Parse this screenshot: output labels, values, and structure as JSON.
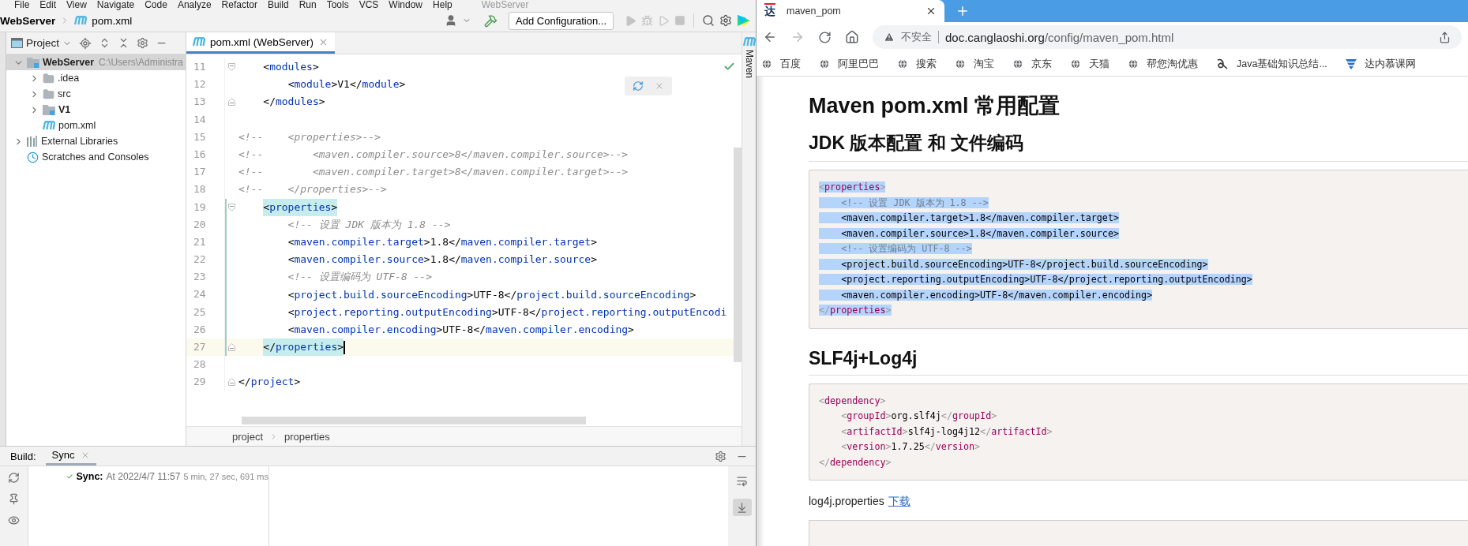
{
  "ide": {
    "menu": [
      "File",
      "Edit",
      "View",
      "Navigate",
      "Code",
      "Analyze",
      "Refactor",
      "Build",
      "Run",
      "Tools",
      "VCS",
      "Window",
      "Help"
    ],
    "title": "WebServer",
    "breadcrumb": [
      "WebServer",
      "pom.xml"
    ],
    "run_config": "Add Configuration...",
    "project": {
      "title": "Project",
      "tree": [
        {
          "label": "WebServer",
          "detail": "C:\\Users\\Administra",
          "kind": "module",
          "expanded": true,
          "selected": true,
          "children": [
            {
              "label": ".idea",
              "kind": "folder",
              "expanded": false,
              "selected": false
            },
            {
              "label": "src",
              "kind": "folder",
              "expanded": false,
              "selected": false
            },
            {
              "label": "V1",
              "kind": "module",
              "expanded": false,
              "selected": false
            },
            {
              "label": "pom.xml",
              "kind": "maven",
              "selected": false
            }
          ]
        },
        {
          "label": "External Libraries",
          "kind": "libraries",
          "expanded": false,
          "selected": false
        },
        {
          "label": "Scratches and Consoles",
          "kind": "scratches",
          "selected": false
        }
      ]
    },
    "editor": {
      "tab": {
        "label": "pom.xml (WebServer)",
        "selected": true
      },
      "lines": [
        {
          "n": "11",
          "kind": "code",
          "text": "    <modules>",
          "matched": false,
          "changed": false,
          "current": false,
          "fold_start": true,
          "fold_end": false
        },
        {
          "n": "12",
          "kind": "code",
          "text": "        <module>V1</module>",
          "matched": false,
          "changed": false,
          "current": false,
          "fold_start": false,
          "fold_end": false
        },
        {
          "n": "13",
          "kind": "code",
          "text": "    </modules>",
          "matched": false,
          "changed": false,
          "current": false,
          "fold_start": false,
          "fold_end": true
        },
        {
          "n": "14",
          "changed": false,
          "current": false,
          "fold_start": false,
          "fold_end": false
        },
        {
          "n": "15",
          "kind": "comment",
          "text": "<!--    <properties>-->",
          "changed": false,
          "current": false,
          "fold_start": false,
          "fold_end": false
        },
        {
          "n": "16",
          "kind": "comment",
          "text": "<!--        <maven.compiler.source>8</maven.compiler.source>-->",
          "changed": false,
          "current": false,
          "fold_start": false,
          "fold_end": false
        },
        {
          "n": "17",
          "kind": "comment",
          "text": "<!--        <maven.compiler.target>8</maven.compiler.target>-->",
          "changed": false,
          "current": false,
          "fold_start": false,
          "fold_end": false
        },
        {
          "n": "18",
          "kind": "comment",
          "text": "<!--    </properties>-->",
          "changed": false,
          "current": false,
          "fold_start": false,
          "fold_end": false
        },
        {
          "n": "19",
          "kind": "code",
          "text": "    <properties>",
          "matched": true,
          "changed": true,
          "current": false,
          "fold_start": true,
          "fold_end": false
        },
        {
          "n": "20",
          "kind": "comment",
          "text": "        <!-- 设置 JDK 版本为 1.8 -->",
          "changed": true,
          "current": false,
          "fold_start": false,
          "fold_end": false
        },
        {
          "n": "21",
          "kind": "code",
          "text": "        <maven.compiler.target>1.8</maven.compiler.target>",
          "matched": false,
          "changed": true,
          "current": false,
          "fold_start": false,
          "fold_end": false
        },
        {
          "n": "22",
          "kind": "code",
          "text": "        <maven.compiler.source>1.8</maven.compiler.source>",
          "matched": false,
          "changed": true,
          "current": false,
          "fold_start": false,
          "fold_end": false
        },
        {
          "n": "23",
          "kind": "comment",
          "text": "        <!-- 设置编码为 UTF-8 -->",
          "changed": true,
          "current": false,
          "fold_start": false,
          "fold_end": false
        },
        {
          "n": "24",
          "kind": "code",
          "text": "        <project.build.sourceEncoding>UTF-8</project.build.sourceEncoding>",
          "matched": false,
          "changed": true,
          "current": false,
          "fold_start": false,
          "fold_end": false
        },
        {
          "n": "25",
          "kind": "code",
          "text": "        <project.reporting.outputEncoding>UTF-8</project.reporting.outputEncodi",
          "matched": false,
          "changed": true,
          "current": false,
          "fold_start": false,
          "fold_end": false
        },
        {
          "n": "26",
          "kind": "code",
          "text": "        <maven.compiler.encoding>UTF-8</maven.compiler.encoding>",
          "matched": false,
          "changed": true,
          "current": false,
          "fold_start": false,
          "fold_end": false
        },
        {
          "n": "27",
          "kind": "code",
          "text": "    </properties>",
          "matched": true,
          "changed": true,
          "current": true,
          "fold_start": false,
          "fold_end": true
        },
        {
          "n": "28",
          "changed": false,
          "current": false,
          "fold_start": false,
          "fold_end": false
        },
        {
          "n": "29",
          "kind": "code",
          "text": "</project>",
          "matched": false,
          "changed": false,
          "current": false,
          "fold_start": false,
          "fold_end": true
        }
      ],
      "breadcrumb": [
        "project",
        "properties"
      ]
    },
    "side_tool": "Maven",
    "build": {
      "label": "Build:",
      "tabs": [
        {
          "label": "Sync",
          "selected": true
        }
      ],
      "rows": [
        {
          "title": "Sync:",
          "time": "At 2022/4/7 11:57",
          "duration": "5 min, 27 sec, 691 ms",
          "kind": "success"
        }
      ],
      "toggles": [
        {
          "kind": "wrap",
          "on": false
        },
        {
          "kind": "scroll",
          "on": true
        }
      ]
    }
  },
  "browser": {
    "tab": {
      "favicon": "达",
      "title": "maven_pom"
    },
    "address": {
      "warning": "不安全",
      "url": "doc.canglaoshi.org/config/maven_pom.html"
    },
    "bookmarks": [
      {
        "label": "百度",
        "kind": "globe"
      },
      {
        "label": "阿里巴巴",
        "kind": "globe"
      },
      {
        "label": "搜索",
        "kind": "globe"
      },
      {
        "label": "淘宝",
        "kind": "globe"
      },
      {
        "label": "京东",
        "kind": "globe"
      },
      {
        "label": "天猫",
        "kind": "globe"
      },
      {
        "label": "帮您淘优惠",
        "kind": "globe"
      },
      {
        "label": "Java基础知识总结...",
        "kind": "swirl"
      },
      {
        "label": "达内慕课网",
        "kind": "funnel"
      }
    ],
    "page": {
      "title": "Maven pom.xml 常用配置",
      "sections": [
        {
          "heading": "JDK 版本配置 和 文件编码",
          "code": {
            "selected": true,
            "lines": [
              {
                "kind": "markup",
                "text": "<properties>"
              },
              {
                "kind": "comment",
                "text": "    <!-- 设置 JDK 版本为 1.8 -->"
              },
              {
                "kind": "plain",
                "text": "    <maven.compiler.target>1.8</maven.compiler.target>"
              },
              {
                "kind": "plain",
                "text": "    <maven.compiler.source>1.8</maven.compiler.source>"
              },
              {
                "kind": "comment",
                "text": "    <!-- 设置编码为 UTF-8 -->"
              },
              {
                "kind": "plain",
                "text": "    <project.build.sourceEncoding>UTF-8</project.build.sourceEncoding>"
              },
              {
                "kind": "plain",
                "text": "    <project.reporting.outputEncoding>UTF-8</project.reporting.outputEncoding>"
              },
              {
                "kind": "plain",
                "text": "    <maven.compiler.encoding>UTF-8</maven.compiler.encoding>"
              },
              {
                "kind": "markup",
                "text": "</properties>"
              }
            ]
          }
        },
        {
          "heading": "SLF4j+Log4j",
          "code": {
            "selected": false,
            "lines": [
              {
                "kind": "markup",
                "text": "<dependency>"
              },
              {
                "kind": "markup",
                "text": "    <groupId>org.slf4j</groupId>"
              },
              {
                "kind": "markup",
                "text": "    <artifactId>slf4j-log4j12</artifactId>"
              },
              {
                "kind": "markup",
                "text": "    <version>1.7.25</version>"
              },
              {
                "kind": "markup",
                "text": "</dependency>"
              }
            ]
          }
        }
      ],
      "paragraph": {
        "text": "log4j.properties",
        "link": "下载"
      }
    }
  }
}
